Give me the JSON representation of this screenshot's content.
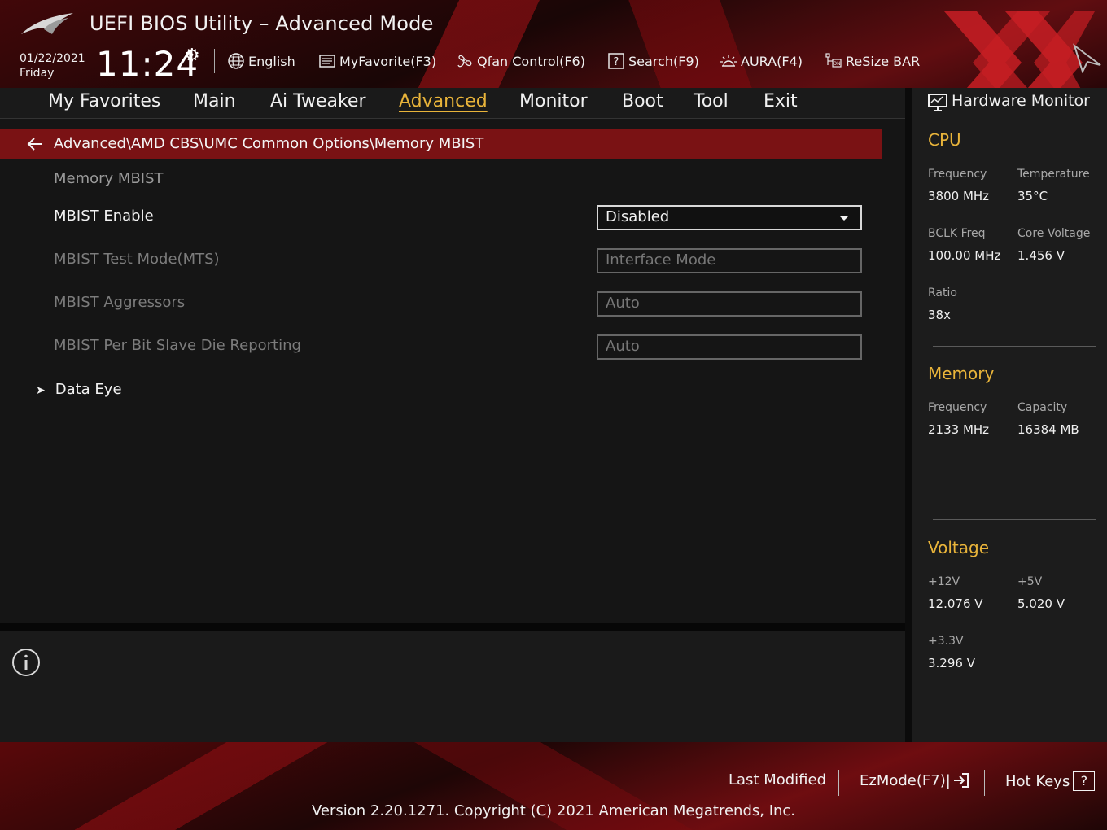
{
  "header": {
    "app_title": "UEFI BIOS Utility – Advanced Mode",
    "date": "01/22/2021",
    "day": "Friday",
    "time": "11:24",
    "tools": {
      "language": "English",
      "my_favorite": "MyFavorite(F3)",
      "qfan": "Qfan Control(F6)",
      "search": "Search(F9)",
      "aura": "AURA(F4)",
      "resize_bar": "ReSize BAR"
    }
  },
  "nav": {
    "tabs": [
      "My Favorites",
      "Main",
      "Ai Tweaker",
      "Advanced",
      "Monitor",
      "Boot",
      "Tool",
      "Exit"
    ],
    "active": "Advanced"
  },
  "main": {
    "breadcrumb": "Advanced\\AMD CBS\\UMC Common Options\\Memory MBIST",
    "section_title": "Memory MBIST",
    "settings": [
      {
        "label": "MBIST Enable",
        "value": "Disabled",
        "enabled": true
      },
      {
        "label": "MBIST Test Mode(MTS)",
        "value": "Interface Mode",
        "enabled": false
      },
      {
        "label": "MBIST Aggressors",
        "value": "Auto",
        "enabled": false
      },
      {
        "label": "MBIST Per Bit Slave Die Reporting",
        "value": "Auto",
        "enabled": false
      }
    ],
    "submenu": "Data Eye"
  },
  "hw_monitor": {
    "title": "Hardware Monitor",
    "cpu": {
      "heading": "CPU",
      "frequency_label": "Frequency",
      "frequency": "3800 MHz",
      "temperature_label": "Temperature",
      "temperature": "35°C",
      "bclk_label": "BCLK Freq",
      "bclk": "100.00 MHz",
      "core_voltage_label": "Core Voltage",
      "core_voltage": "1.456 V",
      "ratio_label": "Ratio",
      "ratio": "38x"
    },
    "memory": {
      "heading": "Memory",
      "frequency_label": "Frequency",
      "frequency": "2133 MHz",
      "capacity_label": "Capacity",
      "capacity": "16384 MB"
    },
    "voltage": {
      "heading": "Voltage",
      "v12_label": "+12V",
      "v12": "12.076 V",
      "v5_label": "+5V",
      "v5": "5.020 V",
      "v33_label": "+3.3V",
      "v33": "3.296 V"
    }
  },
  "footer": {
    "last_modified": "Last Modified",
    "ezmode": "EzMode(F7)|",
    "hot_keys": "Hot Keys",
    "hot_keys_glyph": "?",
    "version": "Version 2.20.1271. Copyright (C) 2021 American Megatrends, Inc."
  },
  "colors": {
    "accent": "#e9b43a",
    "brand_red": "#7a1214",
    "background": "#151515"
  }
}
